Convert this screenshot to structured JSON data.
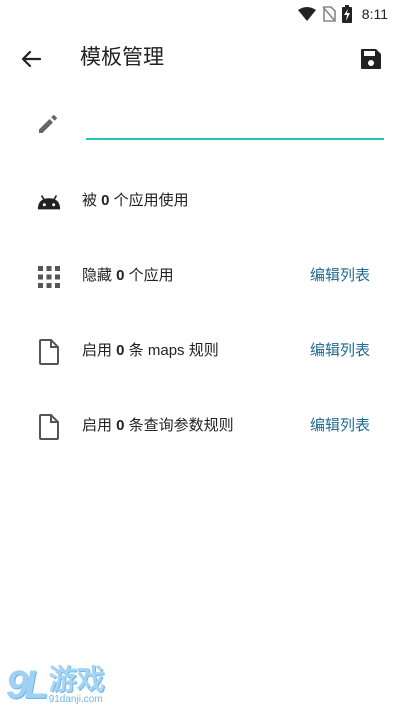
{
  "status_bar": {
    "time": "8:11"
  },
  "header": {
    "title": "模板管理"
  },
  "name_field": {
    "value": ""
  },
  "rows": [
    {
      "prefix": "被 ",
      "count": "0",
      "suffix": " 个应用使用",
      "action": ""
    },
    {
      "prefix": "隐藏 ",
      "count": "0",
      "suffix": " 个应用",
      "action": "编辑列表"
    },
    {
      "prefix": "启用 ",
      "count": "0",
      "suffix": " 条 maps 规则",
      "action": "编辑列表"
    },
    {
      "prefix": "启用 ",
      "count": "0",
      "suffix": " 条查询参数规则",
      "action": "编辑列表"
    }
  ],
  "watermark": {
    "logo": "9L",
    "name": "游戏",
    "site": "91danji.com"
  },
  "colors": {
    "accent": "#26c6b8",
    "link": "#1f6b93"
  }
}
